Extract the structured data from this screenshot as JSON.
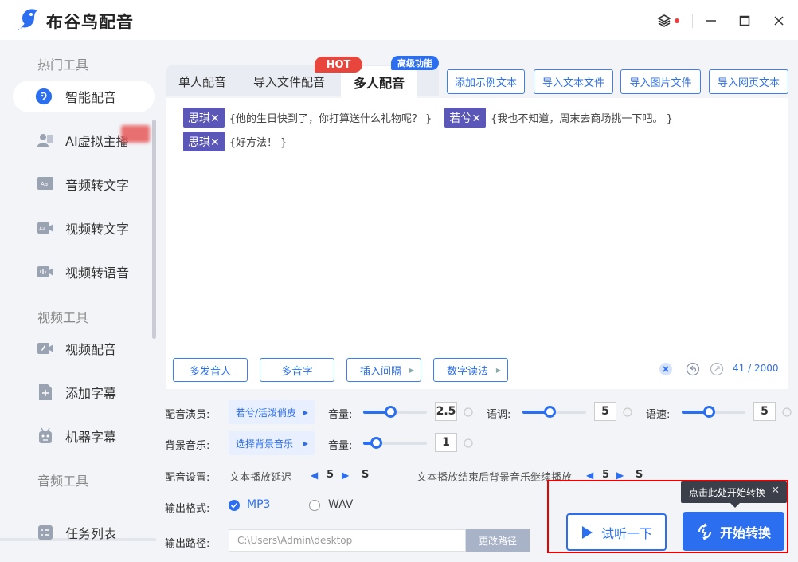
{
  "app": {
    "title": "布谷鸟配音"
  },
  "sidebar": {
    "sections": [
      "热门工具",
      "视频工具",
      "音频工具"
    ],
    "items": [
      {
        "label": "智能配音",
        "icon": "voice-icon",
        "active": true
      },
      {
        "label": "AI虚拟主播",
        "icon": "avatar-icon"
      },
      {
        "label": "音频转文字",
        "icon": "audio-text-icon"
      },
      {
        "label": "视频转文字",
        "icon": "video-text-icon"
      },
      {
        "label": "视频转语音",
        "icon": "video-voice-icon"
      },
      {
        "label": "视频配音",
        "icon": "video-dub-icon"
      },
      {
        "label": "添加字幕",
        "icon": "subtitle-icon"
      },
      {
        "label": "机器字幕",
        "icon": "robot-icon"
      },
      {
        "label": "任务列表",
        "icon": "task-list-icon"
      }
    ]
  },
  "tabs": [
    {
      "label": "单人配音"
    },
    {
      "label": "导入文件配音"
    },
    {
      "label": "多人配音",
      "active": true
    }
  ],
  "badges": {
    "hot": "HOT",
    "advanced": "高级功能"
  },
  "top_buttons": [
    "添加示例文本",
    "导入文本文件",
    "导入图片文件",
    "导入网页文本"
  ],
  "editor": {
    "lines": [
      [
        {
          "speaker": "思琪✕",
          "text": "{他的生日快到了，你打算送什么礼物呢？ }"
        },
        {
          "speaker": "若兮✕",
          "text": "{我也不知道，周末去商场挑一下吧。 }"
        }
      ],
      [
        {
          "speaker": "思琪✕",
          "text": "{好方法！ }"
        }
      ]
    ],
    "buttons": [
      "多发音人",
      "多音字",
      "插入间隔",
      "数字读法"
    ],
    "counter": "41 / 2000"
  },
  "settings": {
    "actor_label": "配音演员:",
    "actor_value": "若兮/活泼俏皮",
    "volume_label": "音量:",
    "volume_value": "2.5",
    "pitch_label": "语调:",
    "pitch_value": "5",
    "speed_label": "语速:",
    "speed_value": "5",
    "bgm_label": "背景音乐:",
    "bgm_value": "选择背景音乐",
    "bgm_volume_label": "音量:",
    "bgm_volume_value": "1",
    "dub_label": "配音设置:",
    "delay_label": "文本播放延迟",
    "delay_value": "5",
    "delay_unit": "S",
    "bg_continue_label": "文本播放结束后背景音乐继续播放",
    "bg_continue_value": "5",
    "bg_continue_unit": "S",
    "format_label": "输出格式:",
    "format_options": [
      {
        "label": "MP3",
        "checked": true
      },
      {
        "label": "WAV",
        "checked": false
      }
    ],
    "path_label": "输出路径:",
    "path_value": "C:\\Users\\Admin\\desktop",
    "path_button": "更改路径"
  },
  "actions": {
    "tooltip": "点击此处开始转换",
    "preview": "试听一下",
    "start": "开始转换"
  },
  "colors": {
    "accent": "#2b6ff0",
    "speaker_tag": "#5b57b8",
    "hot": "#e8453c",
    "highlight": "#ee0000"
  }
}
